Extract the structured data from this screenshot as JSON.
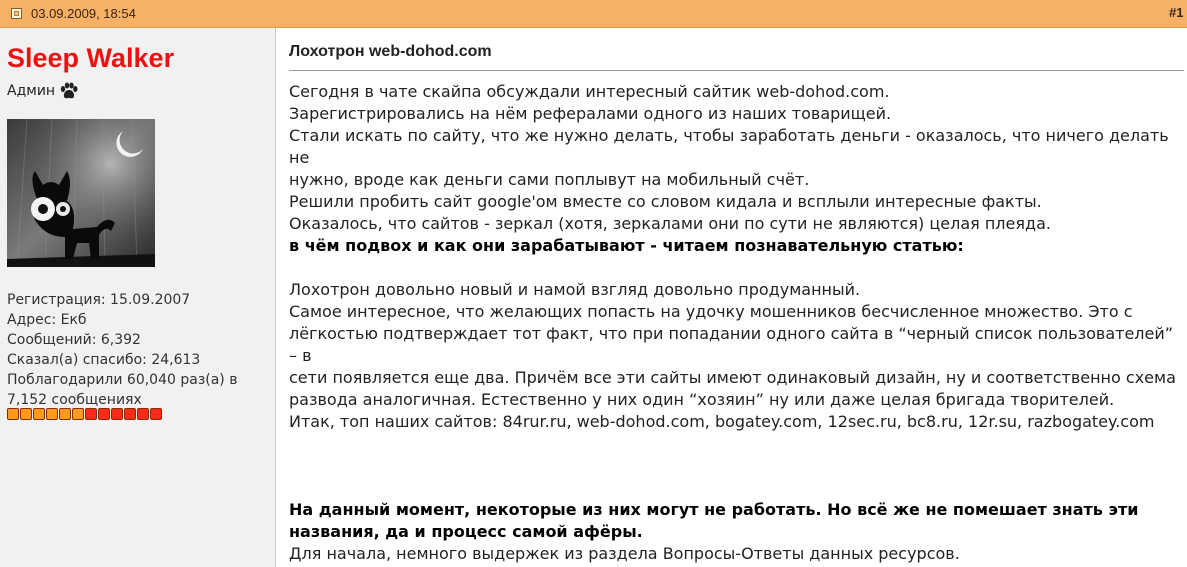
{
  "post": {
    "date": "03.09.2009, 18:54",
    "number": "#1"
  },
  "author": {
    "name": "Sleep Walker",
    "rank": "Админ",
    "stats": [
      "Регистрация: 15.09.2007",
      "Адрес: Екб",
      "Сообщений: 6,392",
      "Сказал(а) спасибо: 24,613",
      "Поблагодарили 60,040 раз(а) в",
      "7,152 сообщениях"
    ],
    "reputation": {
      "orange_blocks": 6,
      "red_blocks": 6,
      "colors": {
        "orange": "#ff9a1a",
        "red": "#ff2a1a"
      }
    }
  },
  "colors": {
    "header_bar": "#f7b166",
    "sidebar_bg": "#f1f1f1",
    "username": "#ee1111"
  },
  "icons": {
    "post_status": "post-status-icon",
    "rank": "paw-icon"
  },
  "content": {
    "title": "Лохотрон web-dohod.com",
    "paragraph1": [
      "Сегодня в чате скайпа обсуждали интересный сайтик web-dohod.com.",
      "Зарегистрировались на нём рефералами одного из наших товарищей.",
      "Стали искать по сайту, что же нужно делать, чтобы заработать деньги - оказалось, что ничего делать не",
      "нужно, вроде как деньги сами поплывут на мобильный счёт.",
      "Решили пробить сайт google'ом вместе со словом кидала и всплыли интересные факты.",
      "Оказалось, что сайтов - зеркал (хотя, зеркалами они по сути не являются) целая плеяда."
    ],
    "heading1": "в чём подвох и как они зарабатывают - читаем познавательную статью:",
    "paragraph2": [
      "Лохотрон довольно новый и намой взгляд довольно продуманный.",
      "Самое интересное, что желающих попасть на удочку мошенников бесчисленное множество. Это с",
      "лёгкостью подтверждает тот факт, что при попадании одного сайта в “черный список пользователей” – в",
      "сети появляется еще два. Причём все эти сайты имеют одинаковый дизайн, ну и соответственно схема",
      "развода аналогичная. Естественно у них один “хозяин” ну или даже целая бригада творителей."
    ],
    "sites_line": "Итак, топ наших сайтов: 84rur.ru, web-dohod.com, bogatey.com, 12sec.ru, bc8.ru, 12r.su, razbogatey.com",
    "heading2": [
      "На данный момент, некоторые из них могут не работать. Но всё же не помешает знать эти",
      "названия, да и процесс самой афёры."
    ],
    "last_line": "Для начала, немного выдержек из раздела Вопросы-Ответы данных ресурсов."
  }
}
